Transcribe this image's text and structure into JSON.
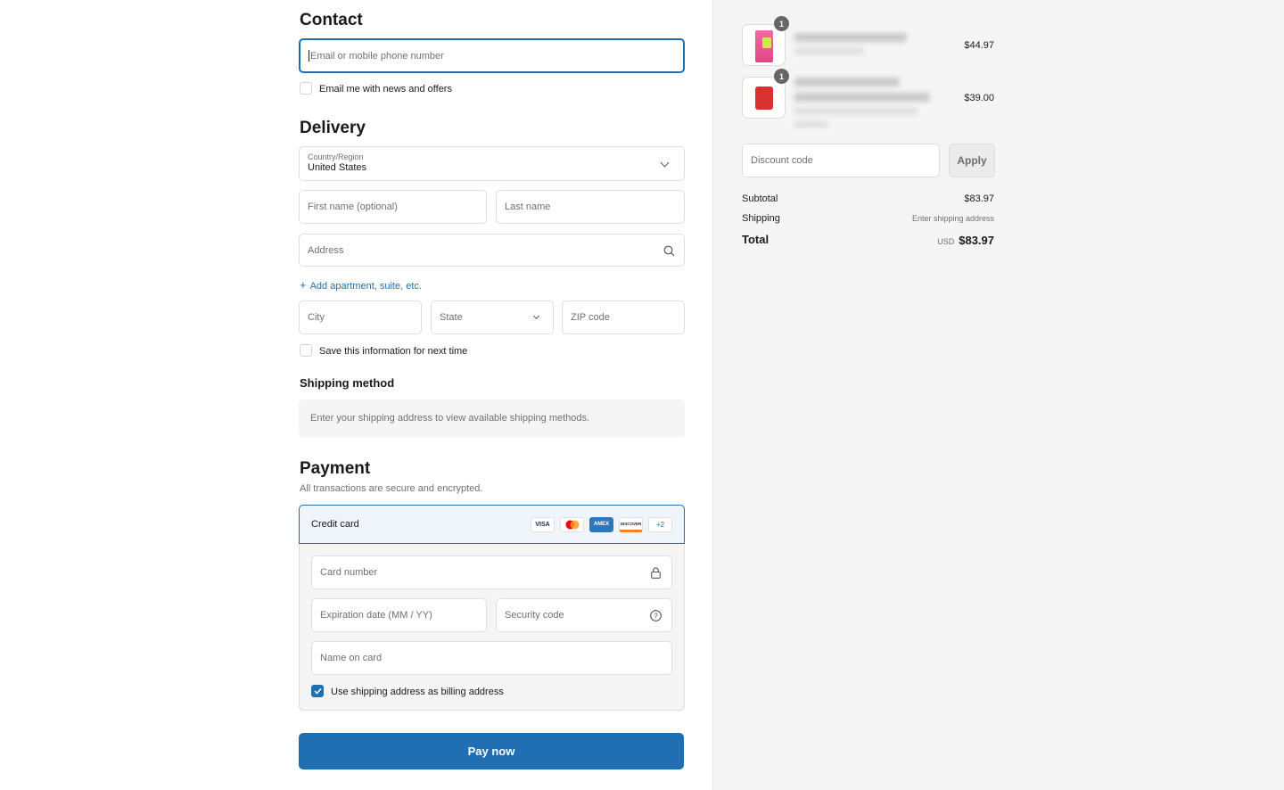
{
  "contact": {
    "heading": "Contact",
    "email_placeholder": "Email or mobile phone number",
    "newsletter_label": "Email me with news and offers"
  },
  "delivery": {
    "heading": "Delivery",
    "country_label": "Country/Region",
    "country_value": "United States",
    "first_name_placeholder": "First name (optional)",
    "last_name_placeholder": "Last name",
    "address_placeholder": "Address",
    "add_apartment": "Add apartment, suite, etc.",
    "city_placeholder": "City",
    "state_placeholder": "State",
    "zip_placeholder": "ZIP code",
    "save_info_label": "Save this information for next time"
  },
  "shipping_method": {
    "heading": "Shipping method",
    "notice": "Enter your shipping address to view available shipping methods."
  },
  "payment": {
    "heading": "Payment",
    "subtitle": "All transactions are secure and encrypted.",
    "credit_card_label": "Credit card",
    "card_brands": [
      "VISA",
      "mastercard",
      "AMEX",
      "DISCOVER"
    ],
    "more_brands": "+2",
    "card_number_placeholder": "Card number",
    "expiration_placeholder": "Expiration date (MM / YY)",
    "security_code_placeholder": "Security code",
    "name_on_card_placeholder": "Name on card",
    "billing_same_label": "Use shipping address as billing address",
    "billing_same_checked": true,
    "pay_button": "Pay now"
  },
  "summary": {
    "items": [
      {
        "quantity": "1",
        "price": "$44.97"
      },
      {
        "quantity": "1",
        "price": "$39.00"
      }
    ],
    "discount_placeholder": "Discount code",
    "apply_button": "Apply",
    "subtotal_label": "Subtotal",
    "subtotal_value": "$83.97",
    "shipping_label": "Shipping",
    "shipping_value": "Enter shipping address",
    "total_label": "Total",
    "currency": "USD",
    "total_value": "$83.97"
  },
  "colors": {
    "accent": "#1f6fb2",
    "summary_bg": "#f5f5f5"
  }
}
